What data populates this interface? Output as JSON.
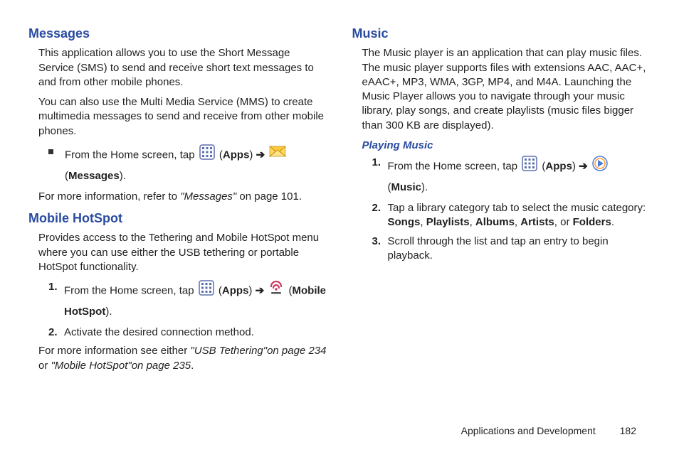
{
  "left": {
    "messages": {
      "h": "Messages",
      "p1": "This application allows you to use the Short Message Service (SMS) to send and receive short text messages to and from other mobile phones.",
      "p2": "You can also use the Multi Media Service (MMS) to create multimedia messages to send and receive from other mobile phones.",
      "bullet": {
        "pre": "From the Home screen, tap ",
        "apps": "Apps",
        "arrow": "➔",
        "msg": "Messages"
      },
      "p3a": "For more information, refer to ",
      "p3b": "\"Messages\"",
      "p3c": "  on page 101."
    },
    "hotspot": {
      "h": "Mobile HotSpot",
      "p1": "Provides access to the Tethering and Mobile HotSpot menu where you can use either the USB tethering or portable HotSpot functionality.",
      "li1": {
        "num": "1.",
        "pre": "From the Home screen, tap ",
        "apps": "Apps",
        "arrow": "➔",
        "mhs": "Mobile HotSpot"
      },
      "li2": {
        "num": "2.",
        "text": "Activate the desired connection method."
      },
      "p2a": "For more information see either ",
      "p2b": "\"USB Tethering\"on page 234",
      "p2c": " or ",
      "p2d": "\"Mobile HotSpot\"on page 235"
    }
  },
  "right": {
    "music": {
      "h": "Music",
      "p1": "The Music player is an application that can play music files. The music player supports files with extensions AAC, AAC+, eAAC+, MP3, WMA, 3GP, MP4, and M4A. Launching the Music Player allows you to navigate through your music library, play songs, and create playlists (music files bigger than 300 KB are displayed)."
    },
    "playing": {
      "h": "Playing Music",
      "li1": {
        "num": "1.",
        "pre": "From the Home screen, tap ",
        "apps": "Apps",
        "arrow": "➔",
        "music": "Music"
      },
      "li2": {
        "num": "2.",
        "pre": "Tap a library category tab to select the music category: ",
        "songs": "Songs",
        "playlists": "Playlists",
        "albums": "Albums",
        "artists": "Artists",
        "or": ", or ",
        "folders": "Folders"
      },
      "li3": {
        "num": "3.",
        "text": "Scroll through the list and tap an entry to begin playback."
      }
    }
  },
  "footer": {
    "section": "Applications and Development",
    "page": "182"
  }
}
